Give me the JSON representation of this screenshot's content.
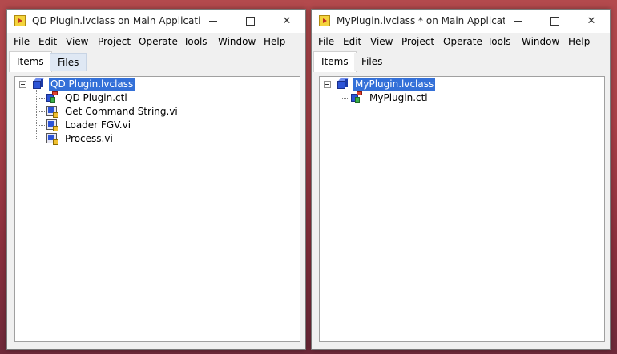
{
  "menu": [
    "File",
    "Edit",
    "View",
    "Project",
    "Operate",
    "Tools",
    "Window",
    "Help"
  ],
  "windows": [
    {
      "title": "QD Plugin.lvclass on Main Applicati...",
      "tabs": [
        "Items",
        "Files"
      ],
      "root": "QD Plugin.lvclass",
      "children": [
        "QD Plugin.ctl",
        "Get Command String.vi",
        "Loader FGV.vi",
        "Process.vi"
      ]
    },
    {
      "title": "MyPlugin.lvclass * on Main Applicati...",
      "tabs": [
        "Items",
        "Files"
      ],
      "root": "MyPlugin.lvclass",
      "children": [
        "MyPlugin.ctl"
      ]
    }
  ],
  "icons": {
    "app": "labview-project-icon",
    "class": "lvclass-cube-icon",
    "control": "ctl-file-icon",
    "vi": "vi-file-icon"
  },
  "colors": {
    "selection": "#3370d8",
    "desktop": "#a83f47"
  }
}
